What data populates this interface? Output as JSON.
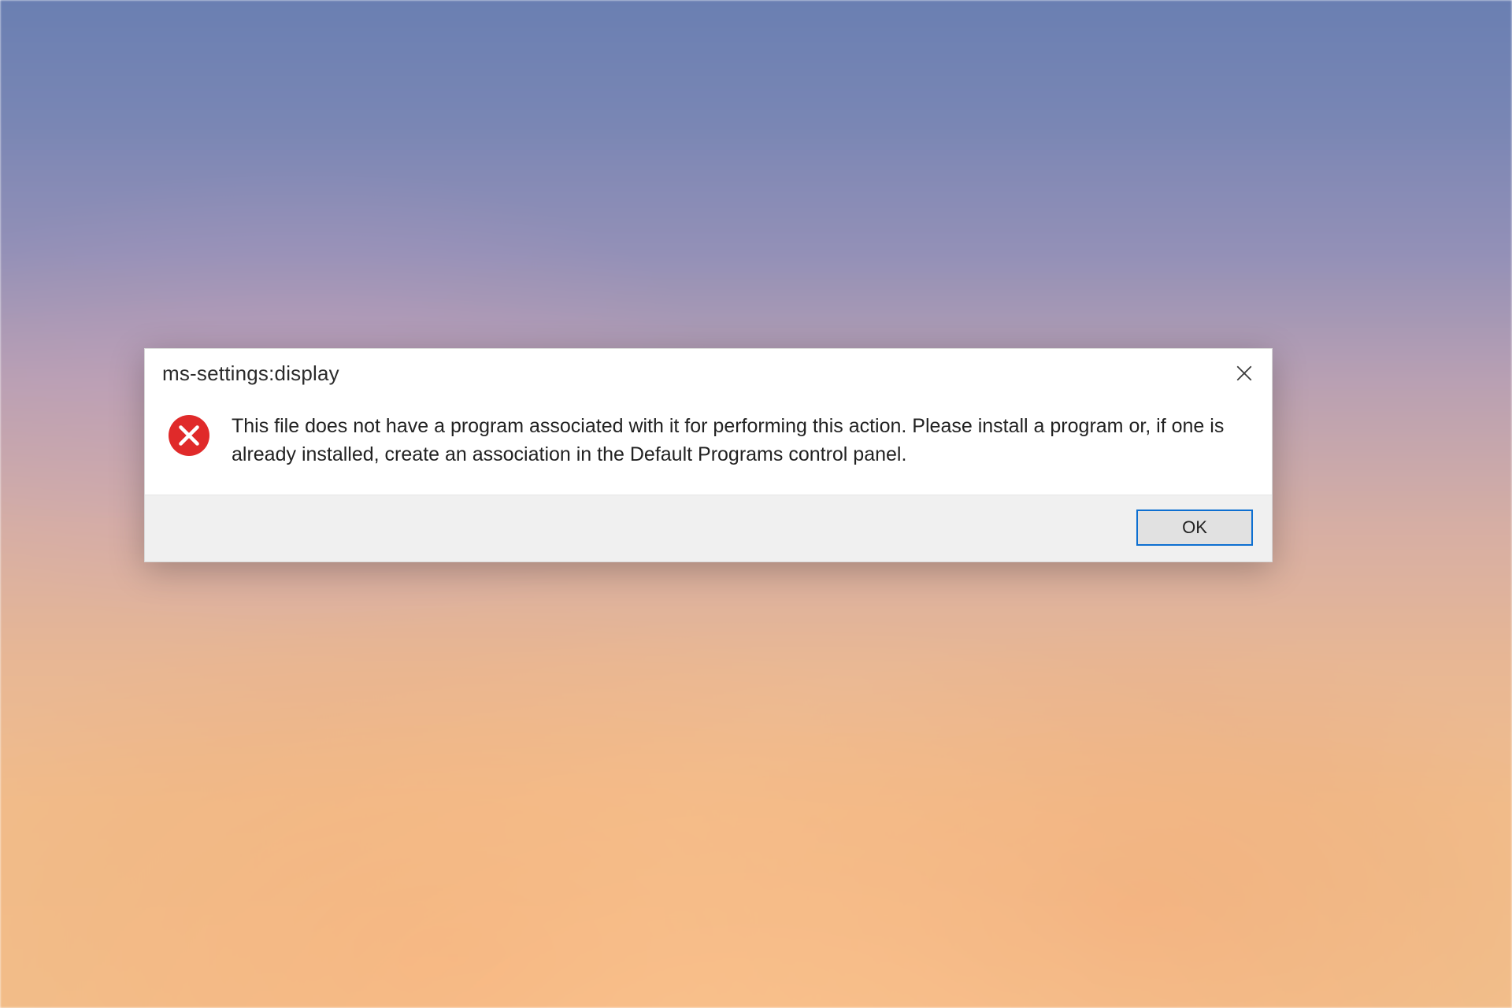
{
  "dialog": {
    "title": "ms-settings:display",
    "message": "This file does not have a program associated with it for performing this action. Please install a program or, if one is already installed, create an association in the Default Programs control panel.",
    "buttons": {
      "ok": "OK"
    },
    "icon": "error"
  }
}
